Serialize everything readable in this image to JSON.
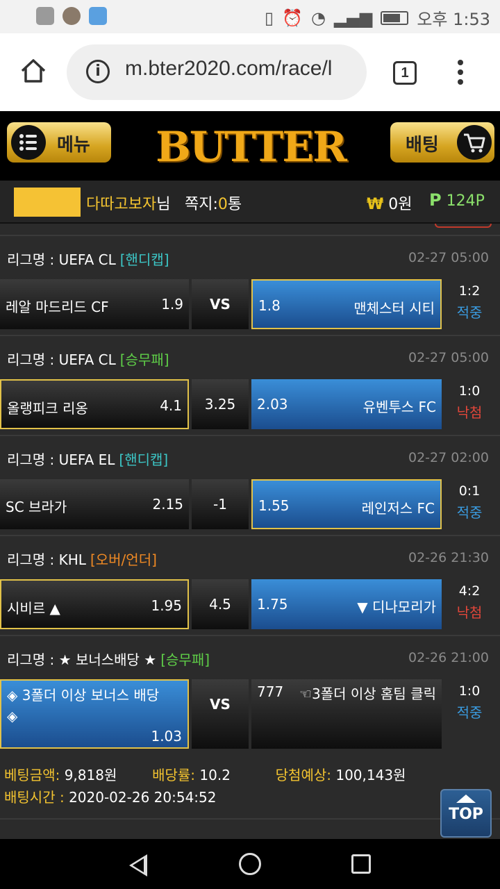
{
  "status_bar": {
    "time": "오후 1:53"
  },
  "browser": {
    "url": "m.bter2020.com/race/l",
    "tab_count": "1"
  },
  "header": {
    "menu_label": "메뉴",
    "logo": "BUTTER",
    "bet_label": "배팅"
  },
  "user": {
    "nickname": "다따고보자",
    "suffix": "님",
    "message_label": "쪽지:",
    "message_count": "0",
    "message_unit": "통",
    "won_symbol": "₩",
    "balance": "0원",
    "points_symbol": "P",
    "points": "124P"
  },
  "colors": {
    "accent_gold": "#f4c430",
    "blue_cell": "#2a6db5",
    "hit": "#3a9be0",
    "miss": "#e0463a"
  },
  "matches": [
    {
      "league": "리그명 : UEFA CL",
      "type": "[핸디캡]",
      "datetime": "02-27 05:00",
      "home": "레알 마드리드 CF",
      "home_odds": "1.9",
      "mid": "VS",
      "away_odds": "1.8",
      "away": "맨체스터 시티",
      "score": "1:2",
      "result": "적중"
    },
    {
      "league": "리그명 : UEFA CL",
      "type": "[승무패]",
      "datetime": "02-27 05:00",
      "home": "올랭피크 리옹",
      "home_odds": "4.1",
      "mid": "3.25",
      "away_odds": "2.03",
      "away": "유벤투스 FC",
      "score": "1:0",
      "result": "낙첨"
    },
    {
      "league": "리그명 : UEFA EL",
      "type": "[핸디캡]",
      "datetime": "02-27 02:00",
      "home": "SC 브라가",
      "home_odds": "2.15",
      "mid": "-1",
      "away_odds": "1.55",
      "away": "레인저스 FC",
      "score": "0:1",
      "result": "적중"
    },
    {
      "league": "리그명 : KHL",
      "type": "[오버/언더]",
      "datetime": "02-26 21:30",
      "home": "시비르 ▲",
      "home_odds": "1.95",
      "mid": "4.5",
      "away_odds": "1.75",
      "away": "▼ 디나모리가",
      "score": "4:2",
      "result": "낙첨"
    },
    {
      "league": "리그명 : ★ 보너스배당 ★",
      "type": "[승무패]",
      "datetime": "02-26 21:00",
      "home": "◈ 3폴더 이상 보너스 배당 ◈",
      "home_odds": "1.03",
      "mid": "VS",
      "away_odds": "777",
      "away": "☜3폴더 이상 홈팀 클릭",
      "score": "1:0",
      "result": "적중"
    }
  ],
  "summary": {
    "amount_label": "베팅금액:",
    "amount": "9,818원",
    "rate_label": "배당률:",
    "rate": "10.2",
    "expect_label": "당첨예상:",
    "expect": "100,143원",
    "time_label": "배팅시간 :",
    "time": "2020-02-26 20:54:52"
  },
  "top_button": "TOP"
}
